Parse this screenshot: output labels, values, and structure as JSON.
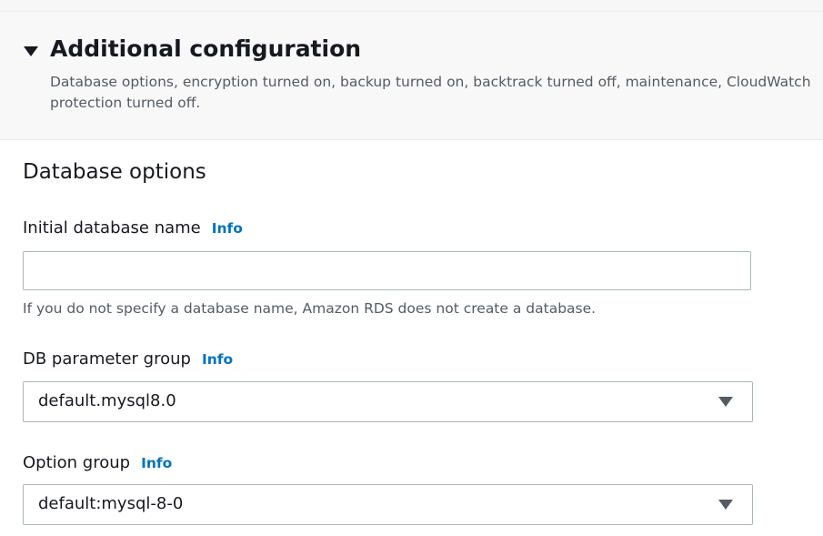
{
  "additional_configuration": {
    "title": "Additional configuration",
    "description_line1": "Database options, encryption turned on, backup turned on, backtrack turned off, maintenance, CloudWatch",
    "description_line2": "protection turned off.",
    "caret_icon": "caret-down-icon"
  },
  "database_options": {
    "title": "Database options",
    "initial_db_name": {
      "label": "Initial database name",
      "info": "Info",
      "value": "",
      "placeholder": "",
      "hint": "If you do not specify a database name, Amazon RDS does not create a database."
    },
    "db_parameter_group": {
      "label": "DB parameter group",
      "info": "Info",
      "selected": "default.mysql8.0"
    },
    "option_group": {
      "label": "Option group",
      "info": "Info",
      "selected": "default:mysql-8-0"
    }
  },
  "colors": {
    "link": "#0073bb",
    "text": "#16191f",
    "secondary_text": "#545b64",
    "border": "#aab7b8",
    "header_bg": "#f8f8f8"
  }
}
